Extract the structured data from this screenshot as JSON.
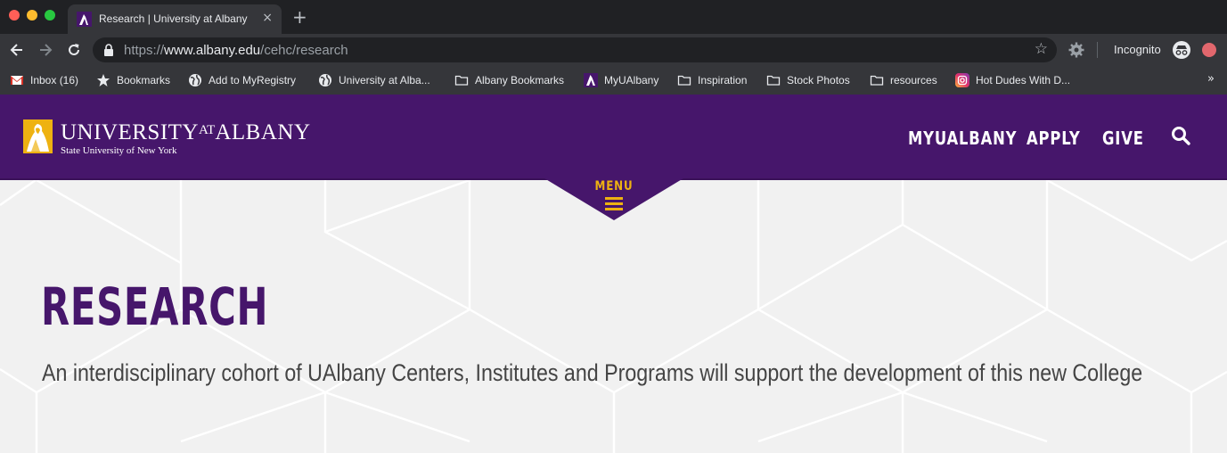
{
  "browser": {
    "tab": {
      "title": "Research | University at Albany",
      "close_glyph": "×"
    },
    "new_tab_glyph": "+",
    "url": {
      "scheme": "https://",
      "host": "www.albany.edu",
      "path": "/cehc/research"
    },
    "incognito_label": "Incognito",
    "bookmarks": [
      {
        "label": "Inbox (16)",
        "icon": "gmail-icon"
      },
      {
        "label": "Bookmarks",
        "icon": "star-icon"
      },
      {
        "label": "Add to MyRegistry",
        "icon": "globe-icon"
      },
      {
        "label": "University at Alba...",
        "icon": "globe-icon"
      },
      {
        "label": "Albany Bookmarks",
        "icon": "folder-icon"
      },
      {
        "label": "MyUAlbany",
        "icon": "ualbany-favicon-icon"
      },
      {
        "label": "Inspiration",
        "icon": "folder-icon"
      },
      {
        "label": "Stock Photos",
        "icon": "folder-icon"
      },
      {
        "label": "resources",
        "icon": "folder-icon"
      },
      {
        "label": "Hot Dudes With D...",
        "icon": "instagram-icon"
      }
    ],
    "more_bookmarks_glyph": "»"
  },
  "site": {
    "logo": {
      "main_a": "UNIVERSITY",
      "main_at": "AT",
      "main_b": "ALBANY",
      "sub": "State University of New York"
    },
    "nav": {
      "myualbany": "MYUALBANY",
      "apply": "APPLY",
      "give": "GIVE"
    },
    "menu_label": "MENU",
    "colors": {
      "purple": "#46166b",
      "gold": "#eeb211"
    }
  },
  "page": {
    "title": "RESEARCH",
    "subtitle": "An interdisciplinary cohort of UAlbany Centers, Institutes and Programs will support the development of this new College"
  }
}
